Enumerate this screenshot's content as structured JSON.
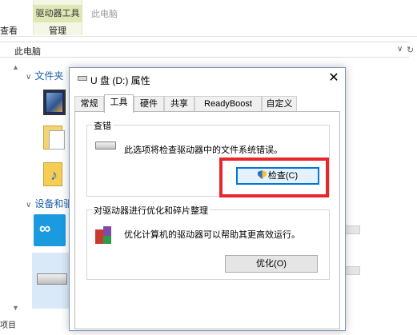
{
  "ribbon": {
    "context_tab": "驱动器工具",
    "this_pc_tab": "此电脑",
    "manage_label": "管理",
    "view_label": "查看"
  },
  "address": {
    "path": "此电脑"
  },
  "nav": {
    "sections": [
      "文件夹",
      "设备和驱"
    ],
    "bottom_text": "项目"
  },
  "dialog": {
    "title": "U 盘 (D:) 属性",
    "close": "✕",
    "tabs": [
      {
        "label": "常规"
      },
      {
        "label": "工具"
      },
      {
        "label": "硬件"
      },
      {
        "label": "共享"
      },
      {
        "label": "ReadyBoost"
      },
      {
        "label": "自定义"
      }
    ],
    "active_tab": "工具",
    "check_group": {
      "title": "查错",
      "description": "此选项将检查驱动器中的文件系统错误。",
      "button_label": "检查(C)"
    },
    "optimize_group": {
      "title": "对驱动器进行优化和碎片整理",
      "description": "优化计算机的驱动器可以帮助其更高效运行。",
      "button_label": "优化(O)"
    }
  },
  "colors": {
    "highlight": "#e8272a",
    "accent": "#0078d7",
    "context_tab_bg": "#dfe7b4"
  }
}
